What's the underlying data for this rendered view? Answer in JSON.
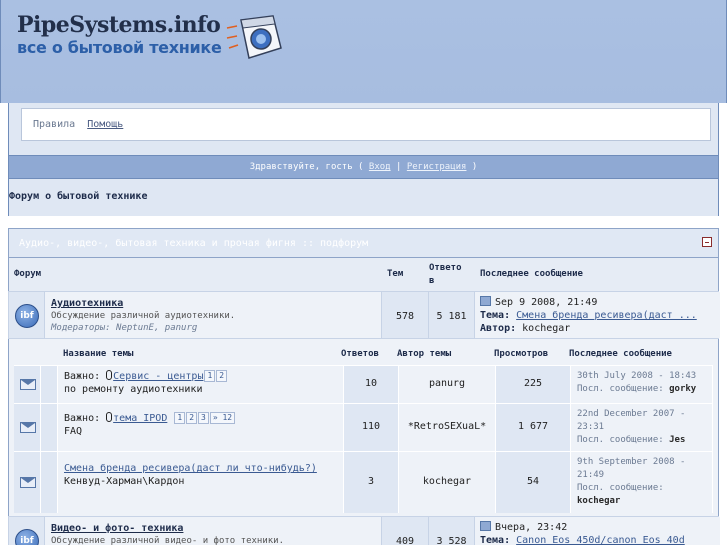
{
  "header": {
    "title": "PipeSystems.info",
    "subtitle": "все о бытовой технике"
  },
  "links": {
    "rules": "Правила",
    "help": "Помощь"
  },
  "welcome": {
    "prefix": "Здравствуйте, гость (",
    "login": "Вход",
    "sep": "|",
    "register": "Регистрация",
    "suffix": ")"
  },
  "breadcrumb": "Форум о бытовой технике",
  "category": {
    "title": "Аудио-, видео-, бытовая техника и прочая фигня :: подфорум"
  },
  "columns": {
    "forum": "Форум",
    "topics": "Тем",
    "replies": "Ответо\nв",
    "last": "Последнее сообщение"
  },
  "forums": [
    {
      "name": "Аудиотехника",
      "desc": "Обсуждение различной аудиотехники.",
      "mods": "Модераторы: NeptunE, panurg",
      "topics": "578",
      "replies": "5 181",
      "last_date": "Sep 9 2008, 21:49",
      "last_topic_label": "Тема:",
      "last_topic": "Смена бренда ресивера(даст ...",
      "last_author_label": "Автор:",
      "last_author": "kochegar"
    },
    {
      "name": "Видео- и фото- техника",
      "desc": "Обсуждение различной видео- и фото техники.",
      "topics": "409",
      "replies": "3 528",
      "last_date": "Вчера, 23:42",
      "last_topic_label": "Тема:",
      "last_topic": "Canon Eos 450d/canon Eos 40d"
    }
  ],
  "topic_columns": {
    "name": "Название темы",
    "replies": "Ответов",
    "author": "Автор темы",
    "views": "Просмотров",
    "last": "Последнее сообщение"
  },
  "topics": [
    {
      "prefix": "Важно:",
      "title": "Сервис - центры",
      "pages": [
        "1",
        "2"
      ],
      "desc": "по ремонту аудиотехники",
      "replies": "10",
      "author": "panurg",
      "views": "225",
      "last_date": "30th July 2008 - 18:43",
      "last_label": "Посл. сообщение:",
      "last_user": "gorky"
    },
    {
      "prefix": "Важно:",
      "title": "тема IPOD",
      "pages": [
        "1",
        "2",
        "3",
        "» 12"
      ],
      "desc": "FAQ",
      "replies": "110",
      "author": "*RetroSEXuaL*",
      "views": "1 677",
      "last_date": "22nd December 2007 - 23:31",
      "last_label": "Посл. сообщение:",
      "last_user": "Jes"
    },
    {
      "title": "Смена бренда ресивера(даст ли что-нибудь?)",
      "desc": "Кенвуд-Харман\\Кардон",
      "replies": "3",
      "author": "kochegar",
      "views": "54",
      "last_date": "9th September 2008 - 21:49",
      "last_label": "Посл. сообщение:",
      "last_user": "kochegar"
    }
  ],
  "colors": {
    "accent": "#8fa9d3",
    "header_bg": "#aac0e2",
    "light_row": "#eef2f8"
  },
  "icons": {
    "logo": "washing-machine-icon",
    "forum": "ibf-forum-icon",
    "topic": "envelope-icon",
    "last_post": "last-post-icon",
    "collapse": "collapse-icon"
  }
}
